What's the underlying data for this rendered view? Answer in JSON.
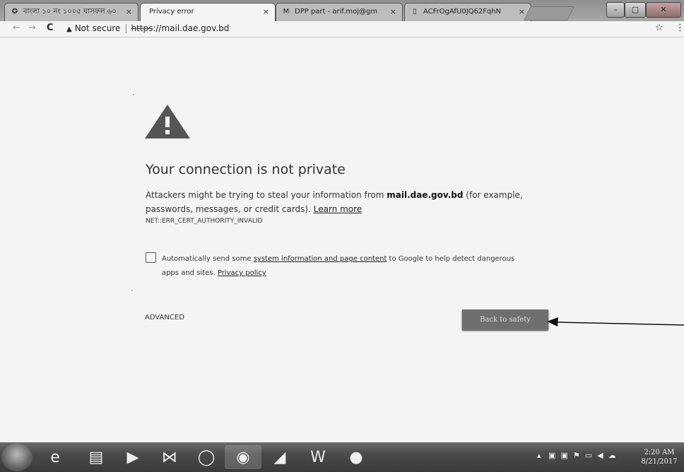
{
  "tabs": [
    {
      "title": "বাংলা ১০ নং ১০০৫ ঘাসফল ৬০",
      "icon": "gear-icon",
      "active": false
    },
    {
      "title": "Privacy error",
      "icon": "",
      "active": true
    },
    {
      "title": "DPP part - arif.moj@gm",
      "icon": "gmail-icon",
      "active": false
    },
    {
      "title": "ACFrOgAfU0JQ62FqhN",
      "icon": "document-icon",
      "active": false
    }
  ],
  "tab_close_glyph": "×",
  "window_controls": {
    "minimize": "–",
    "maximize": "▢",
    "close": "✕"
  },
  "toolbar": {
    "security_label": "Not secure",
    "url_scheme": "https",
    "url_rest": "://mail.dae.gov.bd"
  },
  "interstitial": {
    "title": "Your connection is not private",
    "explanation_prefix": "Attackers might be trying to steal your information from ",
    "domain": "mail.dae.gov.bd",
    "explanation_suffix": " (for example, passwords, messages, or credit cards). ",
    "learn_more": "Learn more",
    "error_code": "NET::ERR_CERT_AUTHORITY_INVALID",
    "optin_prefix": "Automatically send some ",
    "optin_link": "system information and page content",
    "optin_middle": " to Google to help detect dangerous apps and sites. ",
    "privacy_policy": "Privacy policy",
    "advanced": "ADVANCED",
    "back_to_safety": "Back to safety"
  },
  "taskbar": {
    "apps": [
      "internet-explorer-icon",
      "file-explorer-icon",
      "media-player-icon",
      "mail-icon",
      "opera-icon",
      "chrome-icon",
      "scanner-icon",
      "word-icon",
      "media-app-icon"
    ],
    "clock_time": "2:20 AM",
    "clock_date": "8/21/2017"
  }
}
